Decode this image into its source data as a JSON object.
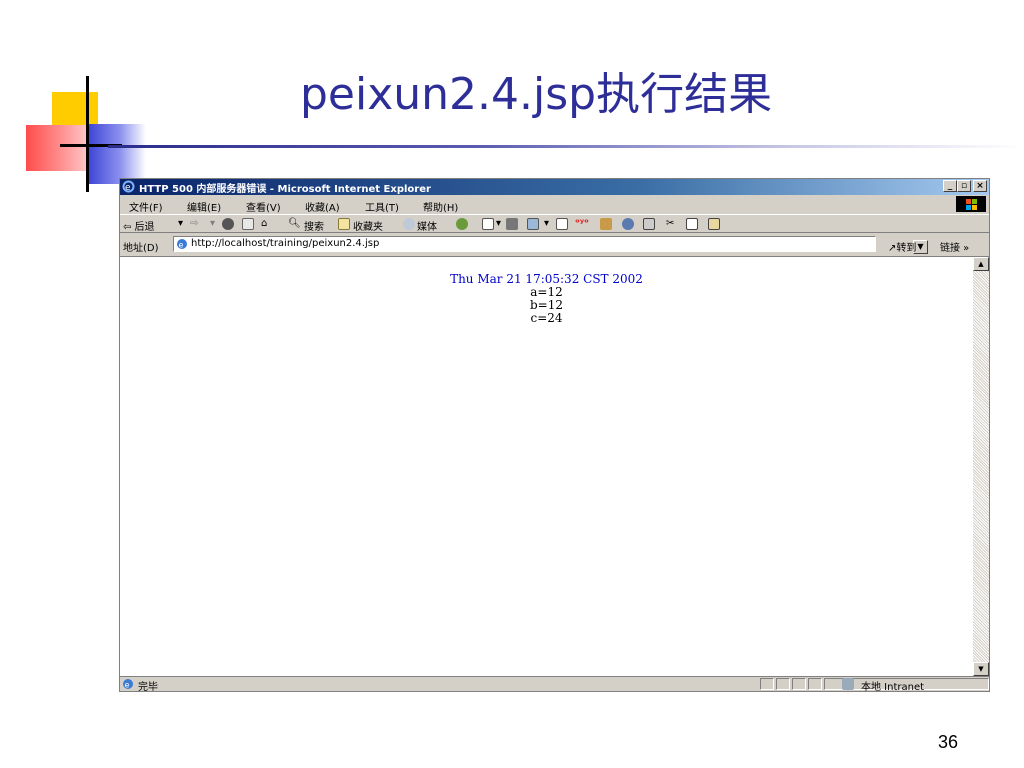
{
  "slide": {
    "title": "peixun2.4.jsp执行结果",
    "page_number": "36"
  },
  "browser": {
    "window_title": "HTTP 500 内部服务器错误 - Microsoft Internet Explorer",
    "menu": [
      "文件(F)",
      "编辑(E)",
      "查看(V)",
      "收藏(A)",
      "工具(T)",
      "帮助(H)"
    ],
    "toolbar": {
      "back": "⇦ 后退",
      "search": "搜索",
      "favorites": "收藏夹",
      "media": "媒体"
    },
    "address": {
      "label": "地址(D)",
      "url": "http://localhost/training/peixun2.4.jsp",
      "go": "转到",
      "links": "链接 »"
    },
    "content": {
      "date": "Thu Mar 21 17:05:32 CST 2002",
      "lines": [
        "a=12",
        "b=12",
        "c=24"
      ]
    },
    "status": {
      "text": "完毕",
      "zone": "本地 Intranet"
    }
  },
  "colors": {
    "title": "#2e2e98",
    "date_text": "#0000cc",
    "titlebar_start": "#0a246a"
  }
}
